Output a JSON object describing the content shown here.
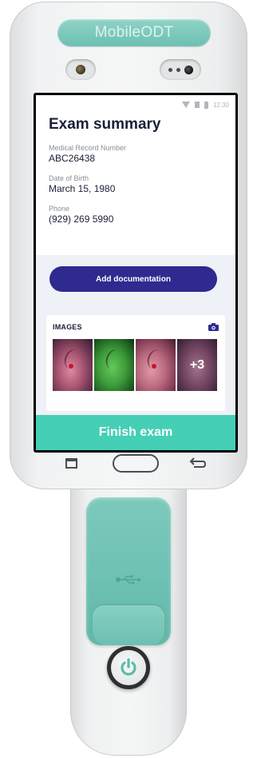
{
  "device": {
    "brand": "MobileODT",
    "accent_color": "#6cc0b2"
  },
  "status_bar": {
    "time": "12:30"
  },
  "exam": {
    "title": "Exam summary",
    "fields": [
      {
        "label": "Medical Record Number",
        "value": "ABC26438"
      },
      {
        "label": "Date of Birth",
        "value": "March 15, 1980"
      },
      {
        "label": "Phone",
        "value": "(929) 269 5990"
      }
    ]
  },
  "actions": {
    "add_documentation": "Add documentation",
    "finish_exam": "Finish exam"
  },
  "images": {
    "title": "IMAGES",
    "more_count": "+3",
    "thumbnails": [
      "colposcopy-image",
      "green-filter-image",
      "colposcopy-image",
      "colposcopy-image"
    ]
  },
  "colors": {
    "primary_button": "#2e2a8f",
    "finish_bar": "#45cfb6",
    "title_text": "#1b1f3a"
  },
  "icons": {
    "camera": "camera-icon",
    "usb": "usb-icon",
    "power": "power-icon",
    "nav_recent": "recent-apps-icon",
    "nav_home": "home-button",
    "nav_back": "back-icon"
  }
}
